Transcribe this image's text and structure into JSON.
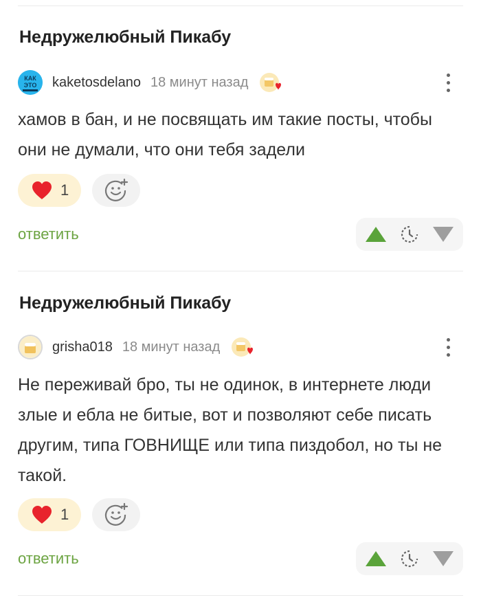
{
  "comments": [
    {
      "post_title": "Недружелюбный Пикабу",
      "username": "kaketosdelano",
      "time": "18 минут назад",
      "avatar_text": [
        "КАК",
        "ЭТО"
      ],
      "body": "хамов в бан, и не посвящать им такие посты, чтобы они не думали, что они тебя задели",
      "like_count": "1",
      "reply_label": "ответить",
      "icons": [
        "heart-icon",
        "smile-add-icon",
        "upvote-icon",
        "clock-icon",
        "downvote-icon",
        "more-vertical-icon"
      ]
    },
    {
      "post_title": "Недружелюбный Пикабу",
      "username": "grisha018",
      "time": "18 минут назад",
      "body": "Не переживай бро, ты не одинок, в интернете люди злые и ебла не битые, вот и позволяют себе писать другим, типа ГОВНИЩЕ или типа пиздобол, но ты не такой.",
      "like_count": "1",
      "reply_label": "ответить",
      "icons": [
        "heart-icon",
        "smile-add-icon",
        "upvote-icon",
        "clock-icon",
        "downvote-icon",
        "more-vertical-icon"
      ]
    }
  ],
  "colors": {
    "accent_green": "#6ca442",
    "heart_red": "#e8232c",
    "like_bg": "#fdf2d4"
  }
}
